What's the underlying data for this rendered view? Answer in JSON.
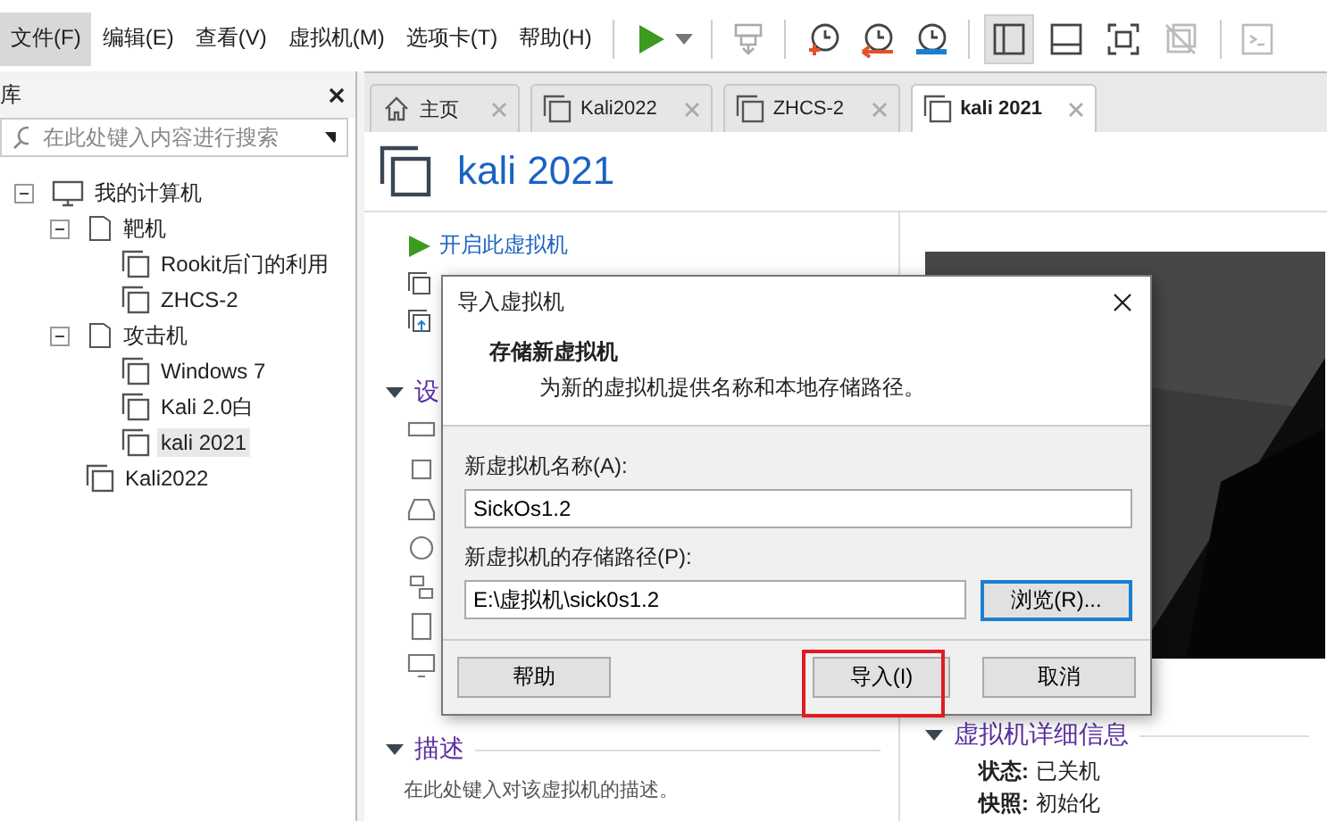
{
  "menu": [
    {
      "label": "文件(F)",
      "selected": true
    },
    {
      "label": "编辑(E)",
      "selected": false
    },
    {
      "label": "查看(V)",
      "selected": false
    },
    {
      "label": "虚拟机(M)",
      "selected": false
    },
    {
      "label": "选项卡(T)",
      "selected": false
    },
    {
      "label": "帮助(H)",
      "selected": false
    }
  ],
  "toolbar": {
    "view_buttons": [
      {
        "selected": true,
        "disabled": false
      },
      {
        "selected": false,
        "disabled": false
      },
      {
        "selected": false,
        "disabled": false
      },
      {
        "selected": false,
        "disabled": true
      }
    ]
  },
  "library": {
    "title": "库",
    "search": {
      "placeholder": "在此处键入内容进行搜索"
    },
    "tree": [
      {
        "label": "我的计算机",
        "kind": "computer",
        "expanded": true,
        "selected": false,
        "children": [
          {
            "label": "靶机",
            "kind": "folder",
            "expanded": true,
            "selected": false,
            "children": [
              {
                "label": "Rookit后门的利用",
                "kind": "vm",
                "selected": false
              },
              {
                "label": "ZHCS-2",
                "kind": "vm",
                "selected": false
              }
            ]
          },
          {
            "label": "攻击机",
            "kind": "folder",
            "expanded": true,
            "selected": false,
            "children": [
              {
                "label": "Windows 7",
                "kind": "vm",
                "selected": false
              },
              {
                "label": "Kali 2.0白",
                "kind": "vm",
                "selected": false
              },
              {
                "label": "kali 2021",
                "kind": "vm",
                "selected": true
              }
            ]
          },
          {
            "label": "Kali2022",
            "kind": "vm",
            "selected": false
          }
        ]
      }
    ]
  },
  "tabs": [
    {
      "label": "主页",
      "kind": "home",
      "selected": false
    },
    {
      "label": "Kali2022",
      "kind": "vm",
      "selected": false
    },
    {
      "label": "ZHCS-2",
      "kind": "vm",
      "selected": false
    },
    {
      "label": "kali 2021",
      "kind": "vm",
      "selected": true
    }
  ],
  "vm": {
    "title": "kali 2021",
    "actions": [
      {
        "label": "开启此虚拟机",
        "kind": "power"
      },
      {
        "kind": "edit"
      }
    ],
    "devices_header": "设",
    "description": {
      "header": "描述",
      "text": "在此处键入对该虚拟机的描述。"
    },
    "details": {
      "header": "虚拟机详细信息",
      "rows": [
        {
          "label": "状态:",
          "value": "已关机"
        },
        {
          "label": "快照:",
          "value": "初始化"
        }
      ]
    }
  },
  "dialog": {
    "title": "导入虚拟机",
    "heading": "存储新虚拟机",
    "subheading": "为新的虚拟机提供名称和本地存储路径。",
    "fields": [
      {
        "label": "新虚拟机名称(A):",
        "value": "SickOs1.2"
      },
      {
        "label": "新虚拟机的存储路径(P):",
        "value": "E:\\虚拟机\\sick0s1.2"
      }
    ],
    "browse": "浏览(R)...",
    "buttons": [
      {
        "label": "帮助",
        "highlighted": false
      },
      {
        "label": "导入(I)",
        "highlighted": true
      },
      {
        "label": "取消",
        "highlighted": false
      }
    ]
  }
}
